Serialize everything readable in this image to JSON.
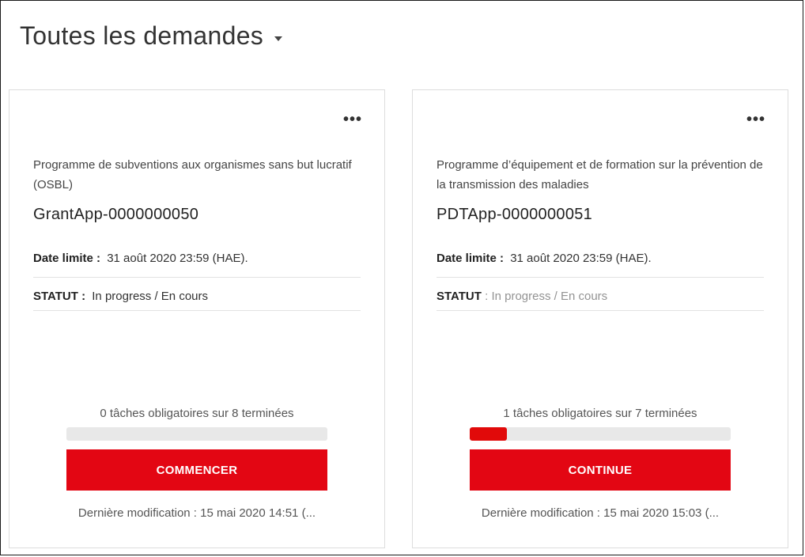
{
  "header": {
    "title": "Toutes les demandes"
  },
  "cards": [
    {
      "program": "Programme de subventions aux organismes sans but lucratif (OSBL)",
      "app_id": "GrantApp-0000000050",
      "deadline_label": "Date limite :",
      "deadline_value": "31 août 2020 23:59 (HAE).",
      "status_label": "STATUT :",
      "status_value": "In progress / En cours",
      "tasks_text": "0 tâches obligatoires sur 8 terminées",
      "progress_fraction": 0.0,
      "button_label": "COMMENCER",
      "modified_text": "Dernière modification : 15 mai 2020 14:51 (..."
    },
    {
      "program": "Programme d’équipement et de formation sur la prévention de la transmission des maladies",
      "app_id": "PDTApp-0000000051",
      "deadline_label": "Date limite :",
      "deadline_value": "31 août 2020 23:59 (HAE).",
      "status_label": "STATUT",
      "status_value": ": In progress / En cours",
      "tasks_text": "1 tâches obligatoires sur 7 terminées",
      "progress_fraction": 0.143,
      "button_label": "CONTINUE",
      "modified_text": "Dernière modification : 15 mai 2020 15:03 (..."
    }
  ],
  "more_icon": "more-horizontal-icon",
  "colors": {
    "accent": "#e30613",
    "progress_track": "#e8e8e8"
  }
}
